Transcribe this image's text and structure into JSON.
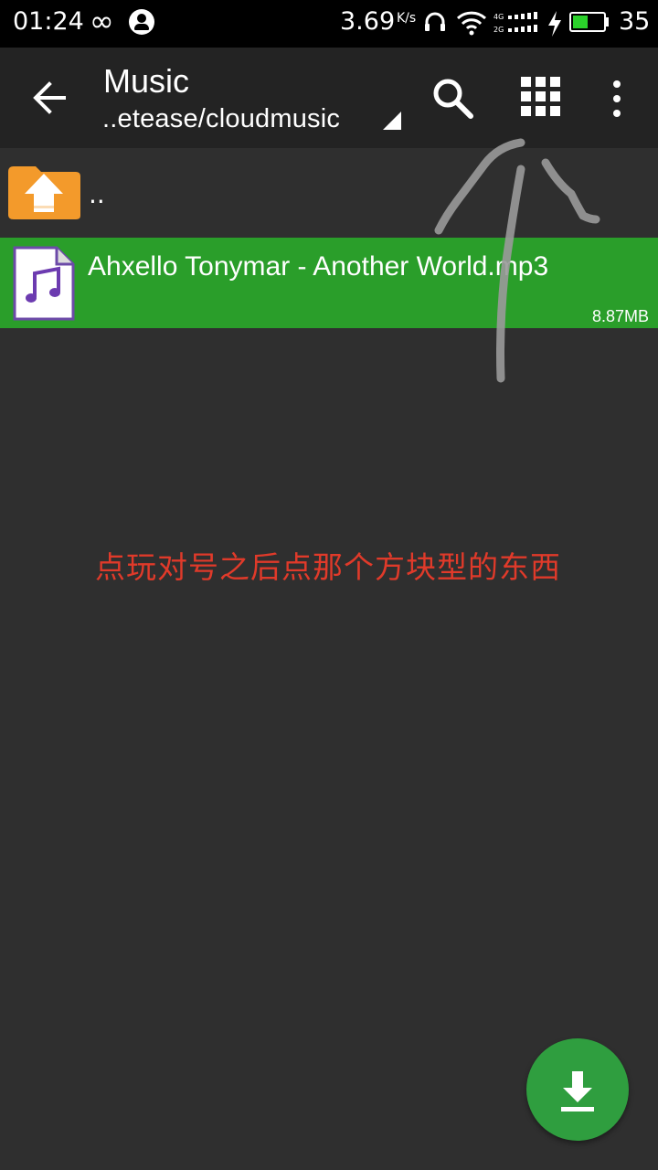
{
  "status_bar": {
    "time": "01:24",
    "net_speed": "3.69",
    "net_unit": "K/s",
    "battery": "35",
    "icons": [
      "infinity-icon",
      "user-icon",
      "headset-icon",
      "wifi-icon",
      "signal-icon",
      "charging-icon",
      "battery-icon"
    ]
  },
  "toolbar": {
    "title": "Music",
    "path": "..etease/cloudmusic",
    "icons": [
      "back-arrow-icon",
      "search-icon",
      "grid-view-icon",
      "more-vert-icon"
    ]
  },
  "list": {
    "parent_label": "..",
    "items": [
      {
        "name": "Ahxello Tonymar - Another World.mp3",
        "size": "8.87MB",
        "icon": "audio-file-icon"
      }
    ]
  },
  "annotation": {
    "text": "点玩对号之后点那个方块型的东西"
  },
  "fab": {
    "icon": "download-icon"
  },
  "colors": {
    "background": "#2f2f2f",
    "toolbar": "#232323",
    "selected_row": "#2a9e2a",
    "fab": "#2f9e3f",
    "annotation": "#e03a2a",
    "folder": "#f39a2b"
  }
}
